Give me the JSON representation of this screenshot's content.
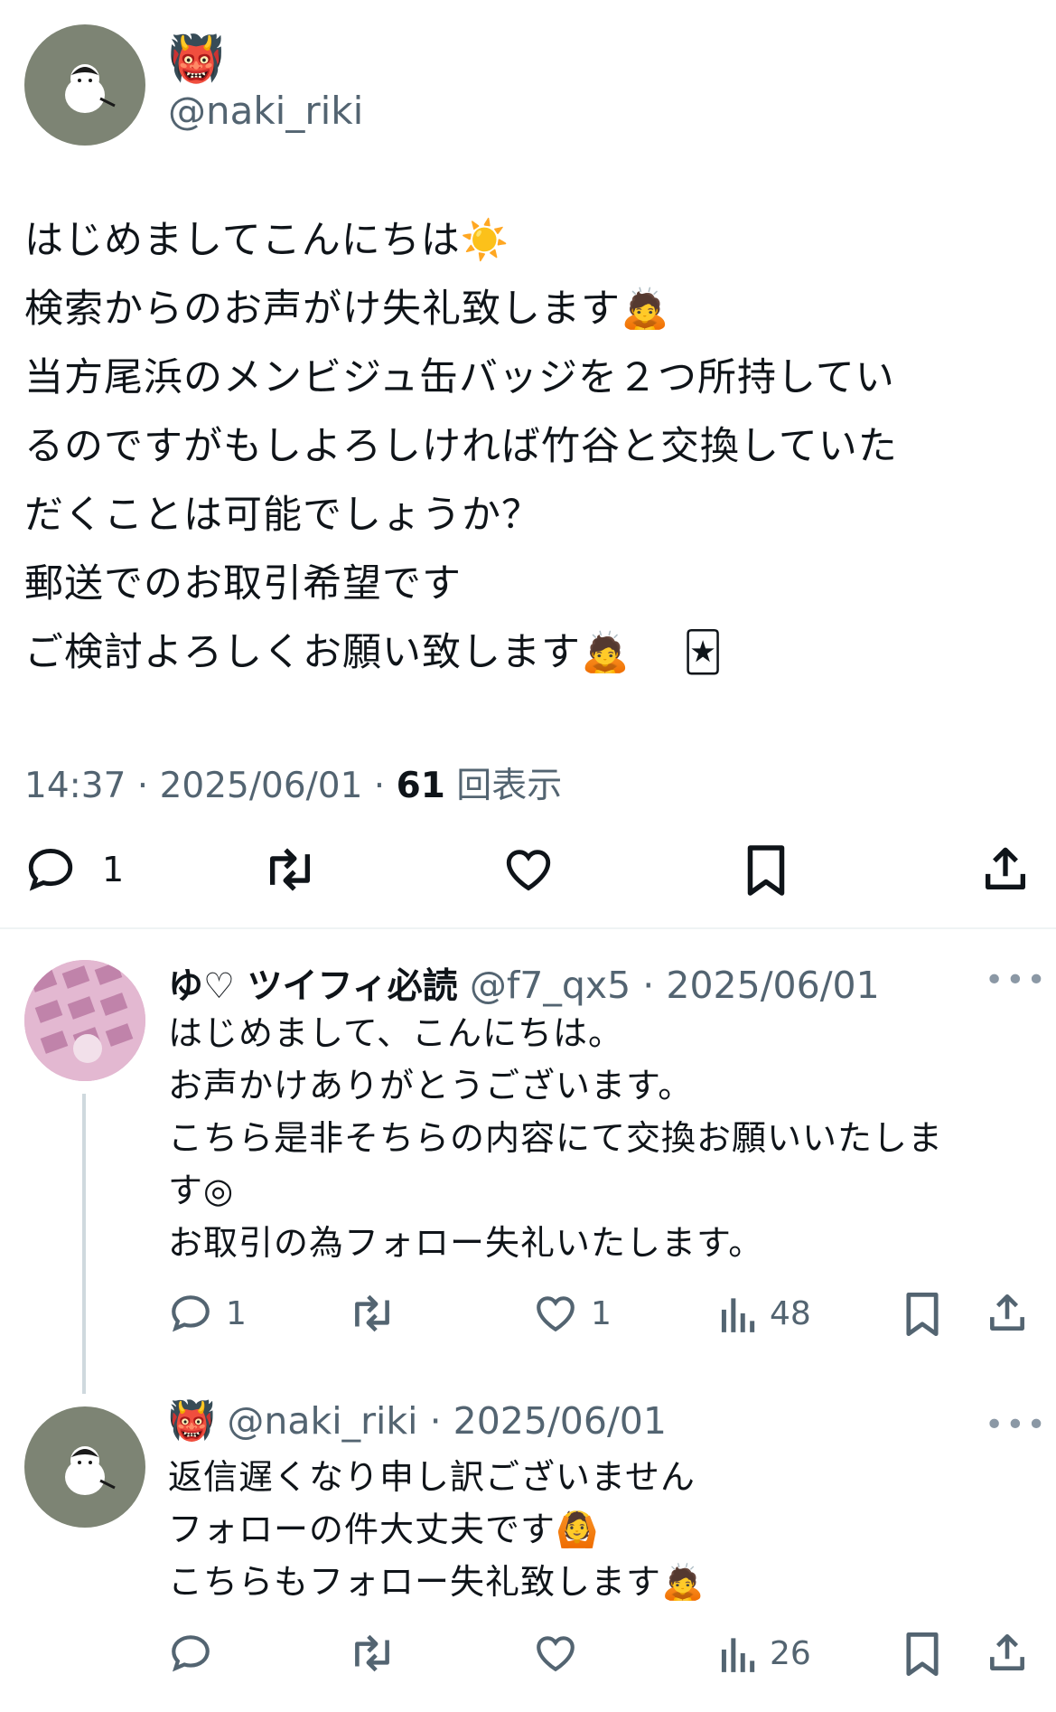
{
  "main_tweet": {
    "author_emoji": "👹",
    "handle": "@naki_riki",
    "lines": [
      "はじめましてこんにちは☀️",
      "検索からのお声がけ失礼致します🙇",
      "当方尾浜のメンビジュ缶バッジを２つ所持してい",
      "るのですがもしよろしければ竹谷と交換していた",
      "だくことは可能でしょうか？",
      "郵送でのお取引希望です",
      "ご検討よろしくお願い致します🙇　 🃏"
    ],
    "time": "14:37",
    "date": "2025/06/01",
    "views_count": "61",
    "views_label": "回表示",
    "actions": {
      "reply_count": "1"
    }
  },
  "replies": [
    {
      "name": "ゆ♡ ツイフィ必読",
      "handle": "@f7_qx5",
      "date": "2025/06/01",
      "more": "•••",
      "lines": [
        "はじめまして、こんにちは。",
        "お声かけありがとうございます。",
        "こちら是非そちらの内容にて交換お願いいたしま",
        "す◎",
        "お取引の為フォロー失礼いたします。"
      ],
      "reply_count": "1",
      "like_count": "1",
      "views": "48"
    },
    {
      "author_emoji": "👹",
      "handle": "@naki_riki",
      "date": "2025/06/01",
      "more": "•••",
      "lines": [
        "返信遅くなり申し訳ございません",
        "フォローの件大丈夫です🙆",
        "こちらもフォロー失礼致します🙇"
      ],
      "views": "26"
    }
  ],
  "sep": " · ",
  "icons": [
    "reply-icon",
    "retweet-icon",
    "like-icon",
    "bookmark-icon",
    "share-icon",
    "views-icon",
    "more-icon"
  ],
  "colors": {
    "text": "#0f1419",
    "secondary": "#536471",
    "divider": "#eff3f4"
  }
}
